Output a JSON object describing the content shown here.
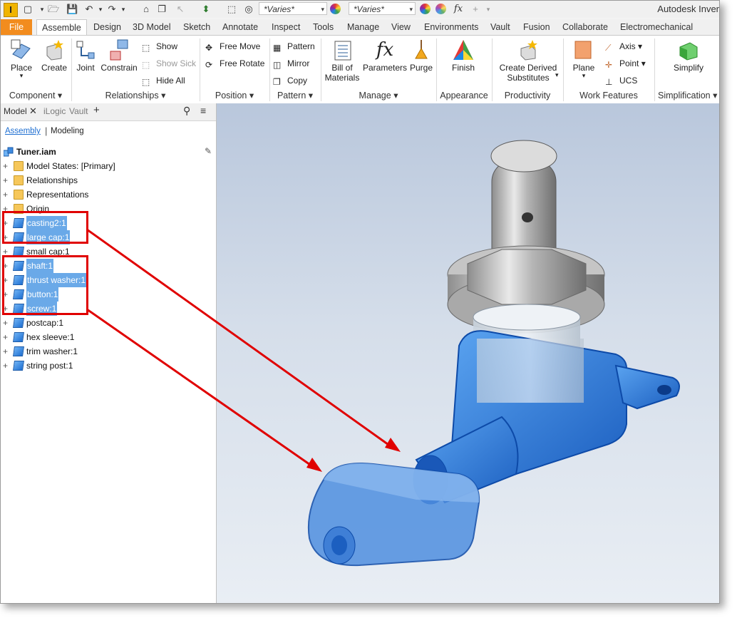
{
  "window": {
    "app_logo": "I",
    "title": "Autodesk Inver",
    "combo_appearance": "*Varies*",
    "combo_material": "*Varies*",
    "qat_fx": "fx"
  },
  "tabs": [
    {
      "label": "File"
    },
    {
      "label": "Assemble"
    },
    {
      "label": "Design"
    },
    {
      "label": "3D Model"
    },
    {
      "label": "Sketch"
    },
    {
      "label": "Annotate"
    },
    {
      "label": "Inspect"
    },
    {
      "label": "Tools"
    },
    {
      "label": "Manage"
    },
    {
      "label": "View"
    },
    {
      "label": "Environments"
    },
    {
      "label": "Vault"
    },
    {
      "label": "Fusion"
    },
    {
      "label": "Collaborate"
    },
    {
      "label": "Electromechanical"
    }
  ],
  "ribbon": {
    "component": {
      "label": "Component",
      "place": "Place",
      "create": "Create"
    },
    "relationships": {
      "label": "Relationships",
      "joint": "Joint",
      "constrain": "Constrain",
      "show": "Show",
      "show_sick": "Show Sick",
      "hide_all": "Hide All"
    },
    "position": {
      "label": "Position",
      "free_move": "Free Move",
      "free_rotate": "Free Rotate"
    },
    "pattern": {
      "label": "Pattern",
      "pattern": "Pattern",
      "mirror": "Mirror",
      "copy": "Copy"
    },
    "manage": {
      "label": "Manage",
      "bom_line1": "Bill of",
      "bom_line2": "Materials",
      "parameters": "Parameters",
      "purge": "Purge",
      "param_fx": "fx"
    },
    "appearance": {
      "label": "Appearance",
      "finish": "Finish"
    },
    "productivity": {
      "label": "Productivity",
      "cds_line1": "Create Derived",
      "cds_line2": "Substitutes"
    },
    "work_features": {
      "label": "Work Features",
      "plane": "Plane",
      "axis": "Axis",
      "point": "Point",
      "ucs": "UCS"
    },
    "simplification": {
      "label": "Simplification",
      "simplify": "Simplify"
    }
  },
  "browser": {
    "tab_model": "Model",
    "tab_ilogic": "iLogic",
    "tab_vault": "Vault",
    "subtab_assembly": "Assembly",
    "subtab_modeling": "Modeling",
    "root": "Tuner.iam",
    "items": [
      {
        "label": "Model States: [Primary]",
        "type": "folder",
        "selected": false
      },
      {
        "label": "Relationships",
        "type": "folder",
        "selected": false
      },
      {
        "label": "Representations",
        "type": "folder",
        "selected": false
      },
      {
        "label": "Origin",
        "type": "folder",
        "selected": false
      },
      {
        "label": "casting2:1",
        "type": "part",
        "selected": true
      },
      {
        "label": "large cap:1",
        "type": "part",
        "selected": true
      },
      {
        "label": "small cap:1",
        "type": "part",
        "selected": false
      },
      {
        "label": "shaft:1",
        "type": "part",
        "selected": true
      },
      {
        "label": "thrust washer:1",
        "type": "part",
        "selected": true
      },
      {
        "label": "button:1",
        "type": "part",
        "selected": true
      },
      {
        "label": "screw:1",
        "type": "part",
        "selected": true
      },
      {
        "label": "postcap:1",
        "type": "part",
        "selected": false
      },
      {
        "label": "hex sleeve:1",
        "type": "part",
        "selected": false
      },
      {
        "label": "trim washer:1",
        "type": "part",
        "selected": false
      },
      {
        "label": "string post:1",
        "type": "part",
        "selected": false
      }
    ]
  },
  "colors": {
    "file_tab": "#f28c1e",
    "selection": "#6aa9e8",
    "highlight_part": "#1f6fd1",
    "annotation_red": "#e00000"
  }
}
